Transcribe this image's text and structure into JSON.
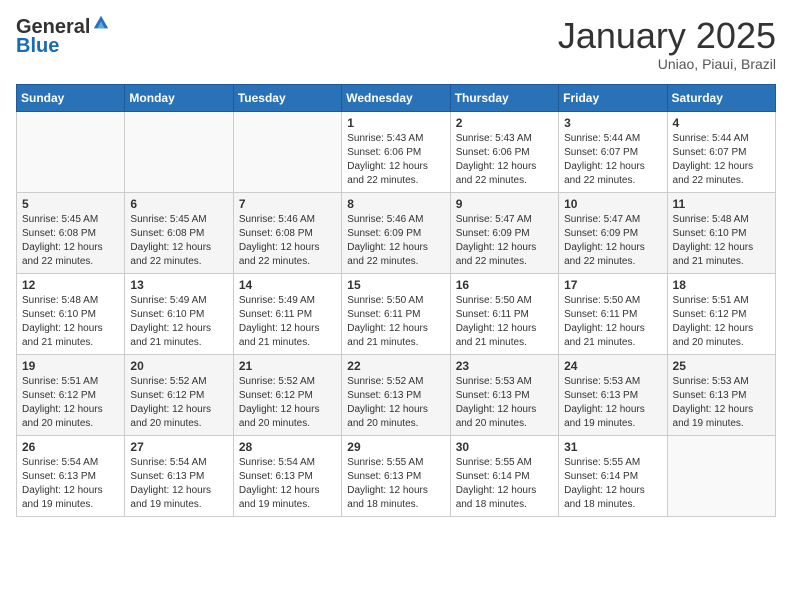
{
  "header": {
    "logo": {
      "general": "General",
      "blue": "Blue"
    },
    "title": "January 2025",
    "subtitle": "Uniao, Piaui, Brazil"
  },
  "days_of_week": [
    "Sunday",
    "Monday",
    "Tuesday",
    "Wednesday",
    "Thursday",
    "Friday",
    "Saturday"
  ],
  "weeks": [
    [
      {
        "day": "",
        "info": ""
      },
      {
        "day": "",
        "info": ""
      },
      {
        "day": "",
        "info": ""
      },
      {
        "day": "1",
        "info": "Sunrise: 5:43 AM\nSunset: 6:06 PM\nDaylight: 12 hours\nand 22 minutes."
      },
      {
        "day": "2",
        "info": "Sunrise: 5:43 AM\nSunset: 6:06 PM\nDaylight: 12 hours\nand 22 minutes."
      },
      {
        "day": "3",
        "info": "Sunrise: 5:44 AM\nSunset: 6:07 PM\nDaylight: 12 hours\nand 22 minutes."
      },
      {
        "day": "4",
        "info": "Sunrise: 5:44 AM\nSunset: 6:07 PM\nDaylight: 12 hours\nand 22 minutes."
      }
    ],
    [
      {
        "day": "5",
        "info": "Sunrise: 5:45 AM\nSunset: 6:08 PM\nDaylight: 12 hours\nand 22 minutes."
      },
      {
        "day": "6",
        "info": "Sunrise: 5:45 AM\nSunset: 6:08 PM\nDaylight: 12 hours\nand 22 minutes."
      },
      {
        "day": "7",
        "info": "Sunrise: 5:46 AM\nSunset: 6:08 PM\nDaylight: 12 hours\nand 22 minutes."
      },
      {
        "day": "8",
        "info": "Sunrise: 5:46 AM\nSunset: 6:09 PM\nDaylight: 12 hours\nand 22 minutes."
      },
      {
        "day": "9",
        "info": "Sunrise: 5:47 AM\nSunset: 6:09 PM\nDaylight: 12 hours\nand 22 minutes."
      },
      {
        "day": "10",
        "info": "Sunrise: 5:47 AM\nSunset: 6:09 PM\nDaylight: 12 hours\nand 22 minutes."
      },
      {
        "day": "11",
        "info": "Sunrise: 5:48 AM\nSunset: 6:10 PM\nDaylight: 12 hours\nand 21 minutes."
      }
    ],
    [
      {
        "day": "12",
        "info": "Sunrise: 5:48 AM\nSunset: 6:10 PM\nDaylight: 12 hours\nand 21 minutes."
      },
      {
        "day": "13",
        "info": "Sunrise: 5:49 AM\nSunset: 6:10 PM\nDaylight: 12 hours\nand 21 minutes."
      },
      {
        "day": "14",
        "info": "Sunrise: 5:49 AM\nSunset: 6:11 PM\nDaylight: 12 hours\nand 21 minutes."
      },
      {
        "day": "15",
        "info": "Sunrise: 5:50 AM\nSunset: 6:11 PM\nDaylight: 12 hours\nand 21 minutes."
      },
      {
        "day": "16",
        "info": "Sunrise: 5:50 AM\nSunset: 6:11 PM\nDaylight: 12 hours\nand 21 minutes."
      },
      {
        "day": "17",
        "info": "Sunrise: 5:50 AM\nSunset: 6:11 PM\nDaylight: 12 hours\nand 21 minutes."
      },
      {
        "day": "18",
        "info": "Sunrise: 5:51 AM\nSunset: 6:12 PM\nDaylight: 12 hours\nand 20 minutes."
      }
    ],
    [
      {
        "day": "19",
        "info": "Sunrise: 5:51 AM\nSunset: 6:12 PM\nDaylight: 12 hours\nand 20 minutes."
      },
      {
        "day": "20",
        "info": "Sunrise: 5:52 AM\nSunset: 6:12 PM\nDaylight: 12 hours\nand 20 minutes."
      },
      {
        "day": "21",
        "info": "Sunrise: 5:52 AM\nSunset: 6:12 PM\nDaylight: 12 hours\nand 20 minutes."
      },
      {
        "day": "22",
        "info": "Sunrise: 5:52 AM\nSunset: 6:13 PM\nDaylight: 12 hours\nand 20 minutes."
      },
      {
        "day": "23",
        "info": "Sunrise: 5:53 AM\nSunset: 6:13 PM\nDaylight: 12 hours\nand 20 minutes."
      },
      {
        "day": "24",
        "info": "Sunrise: 5:53 AM\nSunset: 6:13 PM\nDaylight: 12 hours\nand 19 minutes."
      },
      {
        "day": "25",
        "info": "Sunrise: 5:53 AM\nSunset: 6:13 PM\nDaylight: 12 hours\nand 19 minutes."
      }
    ],
    [
      {
        "day": "26",
        "info": "Sunrise: 5:54 AM\nSunset: 6:13 PM\nDaylight: 12 hours\nand 19 minutes."
      },
      {
        "day": "27",
        "info": "Sunrise: 5:54 AM\nSunset: 6:13 PM\nDaylight: 12 hours\nand 19 minutes."
      },
      {
        "day": "28",
        "info": "Sunrise: 5:54 AM\nSunset: 6:13 PM\nDaylight: 12 hours\nand 19 minutes."
      },
      {
        "day": "29",
        "info": "Sunrise: 5:55 AM\nSunset: 6:13 PM\nDaylight: 12 hours\nand 18 minutes."
      },
      {
        "day": "30",
        "info": "Sunrise: 5:55 AM\nSunset: 6:14 PM\nDaylight: 12 hours\nand 18 minutes."
      },
      {
        "day": "31",
        "info": "Sunrise: 5:55 AM\nSunset: 6:14 PM\nDaylight: 12 hours\nand 18 minutes."
      },
      {
        "day": "",
        "info": ""
      }
    ]
  ]
}
